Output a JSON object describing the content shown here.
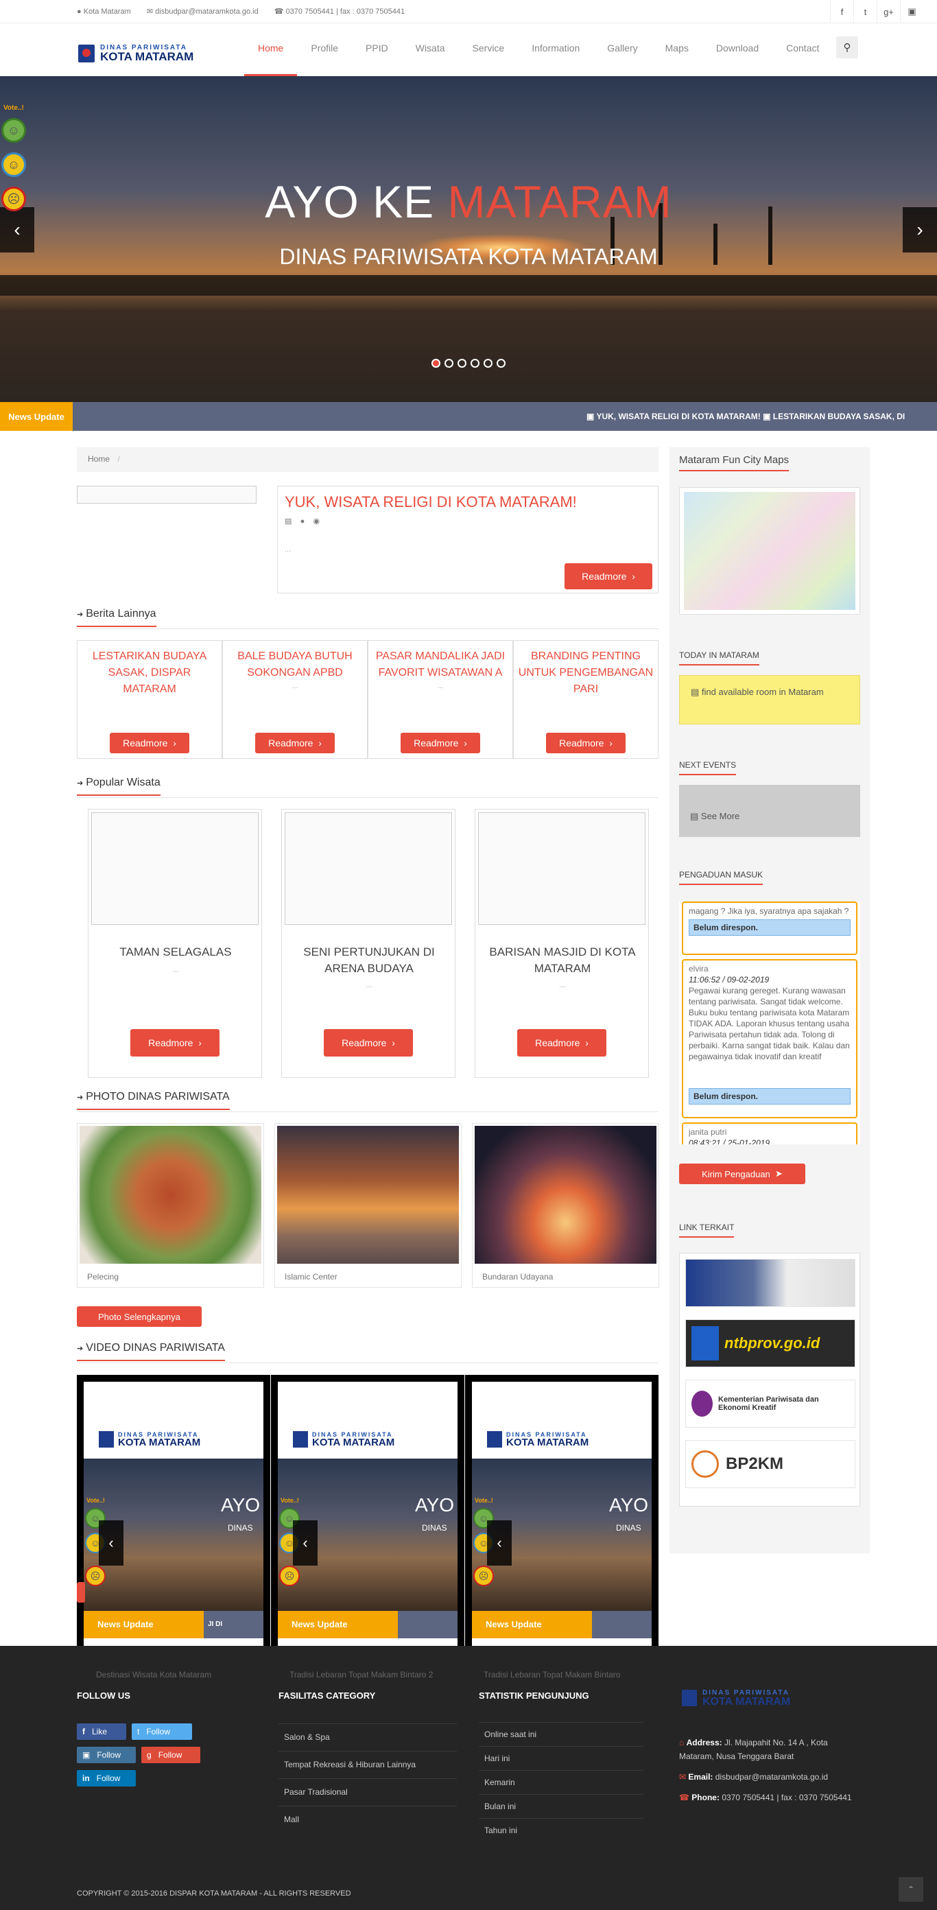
{
  "topbar": {
    "location": "Kota Mataram",
    "email": "disbudpar@mataramkota.go.id",
    "phone": "0370 7505441  |  fax : 0370 7505441",
    "social": [
      "facebook-icon",
      "twitter-icon",
      "google-plus-icon",
      "instagram-icon"
    ]
  },
  "logo": {
    "line1": "DINAS PARIWISATA",
    "line2": "KOTA MATARAM"
  },
  "menu": [
    "Home",
    "Profile",
    "PPID",
    "Wisata",
    "Service",
    "Information",
    "Gallery",
    "Maps",
    "Download",
    "Contact"
  ],
  "hero": {
    "title_a": "AYO KE ",
    "title_b": "MATARAM",
    "subtitle": "DINAS PARIWISATA KOTA MATARAM",
    "vote_label": "Vote..!"
  },
  "ticker": {
    "tag": "News Update",
    "text": "▣ YUK, WISATA RELIGI DI KOTA MATARAM!   ▣ LESTARIKAN BUDAYA SASAK, DI"
  },
  "breadcrumb": {
    "home": "Home",
    "sep": "/"
  },
  "featured": {
    "title": "YUK, WISATA RELIGI DI KOTA MATARAM!",
    "excerpt": "...",
    "button": "Readmore"
  },
  "berita": {
    "heading": "Berita Lainnya",
    "items": [
      {
        "title": "LESTARIKAN BUDAYA SASAK, DISPAR MATARAM",
        "excerpt": "...",
        "button": "Readmore"
      },
      {
        "title": "BALE BUDAYA BUTUH SOKONGAN APBD",
        "excerpt": "...",
        "button": "Readmore"
      },
      {
        "title": "PASAR MANDALIKA JADI FAVORIT WISATAWAN A",
        "excerpt": "...",
        "button": "Readmore"
      },
      {
        "title": "BRANDING PENTING UNTUK PENGEMBANGAN PARI",
        "excerpt": "...",
        "button": "Readmore"
      }
    ]
  },
  "wisata": {
    "heading": "Popular Wisata",
    "items": [
      {
        "title": "TAMAN SELAGALAS",
        "excerpt": "...",
        "button": "Readmore"
      },
      {
        "title": "SENI PERTUNJUKAN DI ARENA BUDAYA",
        "excerpt": "...",
        "button": "Readmore"
      },
      {
        "title": "BARISAN MASJID DI KOTA MATARAM",
        "excerpt": "...",
        "button": "Readmore"
      }
    ]
  },
  "photos": {
    "heading": "PHOTO DINAS PARIWISATA",
    "items": [
      {
        "caption": "Pelecing"
      },
      {
        "caption": "Islamic Center"
      },
      {
        "caption": "Bundaran Udayana"
      }
    ],
    "button": "Photo Selengkapnya"
  },
  "videos": {
    "heading": "VIDEO DINAS PARIWISATA",
    "captions": [
      "Destinasi Wisata Kota Mataram",
      "Tradisi Lebaran Topat Makam Bintaro 2",
      "Tradisi Lebaran Topat Makam Bintaro"
    ],
    "inner_logo_a": "DINAS PARIWISATA",
    "inner_logo_b": "KOTA MATARAM",
    "inner_ayo": "AYO",
    "inner_dinas": "DINAS",
    "inner_vote": "Vote..!",
    "inner_news": "News Update",
    "inner_ticker": "JI DI"
  },
  "sidebar": {
    "maps_title": "Mataram Fun City Maps",
    "today_title": "TODAY IN MATARAM",
    "today_text": "find available room in Mataram",
    "events_title": "NEXT EVENTS",
    "events_text": "See More",
    "pengaduan_title": "PENGADUAN MASUK",
    "pengaduan": [
      {
        "name": "",
        "time": "",
        "text": "magang ? Jika iya, syaratnya apa sajakah ?",
        "status": "Belum direspon."
      },
      {
        "name": "elvira",
        "time": "11:06:52 / 09-02-2019",
        "text": "Pegawai kurang gereget. Kurang wawasan tentang pariwisata. Sangat tidak welcome. Buku buku tentang pariwisata kota Mataram TIDAK ADA. Laporan khusus tentang usaha Pariwisata pertahun tidak ada. Tolong di perbaiki. Karna sangat tidak baik. Kalau dan pegawainya tidak inovatif dan kreatif",
        "status": "Belum direspon."
      },
      {
        "name": "janita putri",
        "time": "08:43:21 / 25-01-2019",
        "text": "",
        "status": ""
      }
    ],
    "kirim_button": "Kirim Pengaduan",
    "links_title": "LINK TERKAIT",
    "links": [
      "",
      "ntbprov.go.id",
      "Kementerian Pariwisata dan Ekonomi Kreatif",
      "BP2KM"
    ]
  },
  "footer": {
    "follow_title": "FOLLOW US",
    "follow": [
      "Like",
      "Follow",
      "Follow",
      "Follow",
      "Follow"
    ],
    "fasilitas_title": "FASILITAS CATEGORY",
    "fasilitas": [
      "Salon & Spa",
      "Tempat Rekreasi & Hiburan Lainnya",
      "Pasar Tradisional",
      "Mall"
    ],
    "statistik_title": "STATISTIK PENGUNJUNG",
    "statistik": [
      "Online saat ini",
      "Hari ini",
      "Kemarin",
      "Bulan ini",
      "Tahun ini"
    ],
    "logo_a": "DINAS PARIWISATA",
    "logo_b": "KOTA MATARAM",
    "address_label": "Address:",
    "address": "Jl. Majapahit No. 14 A , Kota Mataram, Nusa Tenggara Barat",
    "email_label": "Email:",
    "email": "disbudpar@mataramkota.go.id",
    "phone_label": "Phone:",
    "phone": "0370 7505441  |  fax : 0370 7505441",
    "copyright": "COPYRIGHT © 2015-2016 DISPAR KOTA MATARAM - ALL RIGHTS RESERVED"
  },
  "colors": {
    "accent": "#e74c3c",
    "ticker_tag": "#f5a600",
    "ticker_bg": "#5d6680",
    "footer_bg": "#252525"
  }
}
